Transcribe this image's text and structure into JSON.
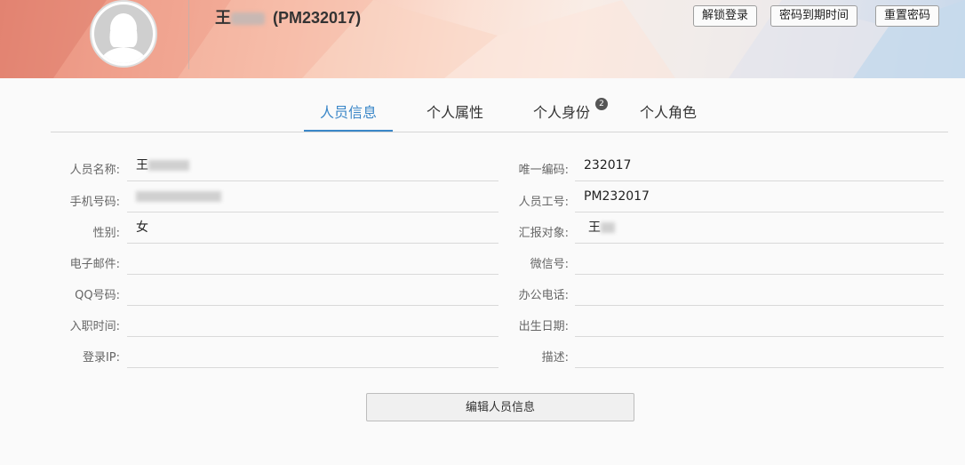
{
  "header": {
    "name_visible": "王",
    "employee_code": "(PM232017)",
    "buttons": {
      "unlock": "解锁登录",
      "password_expiry": "密码到期时间",
      "reset_password": "重置密码"
    }
  },
  "tabs": [
    {
      "label": "人员信息",
      "active": true
    },
    {
      "label": "个人属性",
      "active": false
    },
    {
      "label": "个人身份",
      "active": false,
      "badge": "2"
    },
    {
      "label": "个人角色",
      "active": false
    }
  ],
  "form": {
    "left": [
      {
        "label": "人员名称:",
        "value": "王"
      },
      {
        "label": "手机号码:",
        "value": ""
      },
      {
        "label": "性别:",
        "value": "女"
      },
      {
        "label": "电子邮件:",
        "value": ""
      },
      {
        "label": "QQ号码:",
        "value": ""
      },
      {
        "label": "入职时间:",
        "value": ""
      },
      {
        "label": "登录IP:",
        "value": ""
      }
    ],
    "right": [
      {
        "label": "唯一编码:",
        "value": "232017"
      },
      {
        "label": "人员工号:",
        "value": "PM232017"
      },
      {
        "label": "汇报对象:",
        "value": "王"
      },
      {
        "label": "微信号:",
        "value": ""
      },
      {
        "label": "办公电话:",
        "value": ""
      },
      {
        "label": "出生日期:",
        "value": ""
      },
      {
        "label": "描述:",
        "value": ""
      }
    ]
  },
  "actions": {
    "edit_label": "编辑人员信息"
  },
  "colors": {
    "accent": "#3b87c8",
    "badge": "#555555"
  }
}
